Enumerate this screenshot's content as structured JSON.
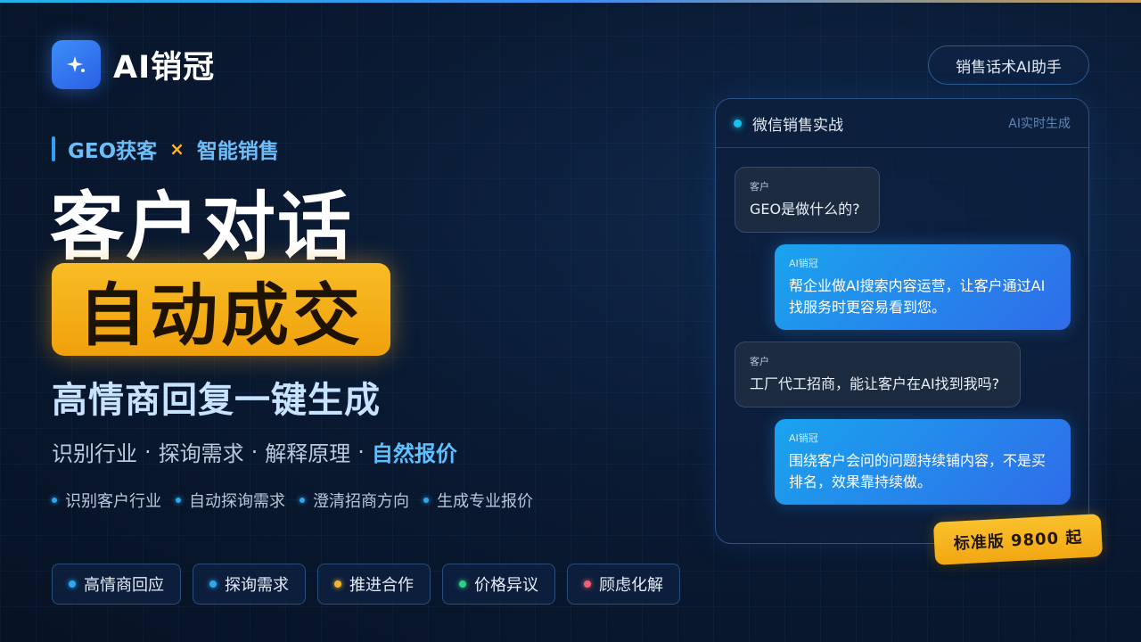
{
  "brand": {
    "name": "AI销冠"
  },
  "header": {
    "assistant_label": "销售话术AI助手"
  },
  "tagline": {
    "left": "GEO获客",
    "sep": "×",
    "right": "智能销售"
  },
  "hero": {
    "line1": "客户对话",
    "line2": "自动成交",
    "line3": "高情商回复一键生成"
  },
  "subline": {
    "items": [
      "识别行业",
      "探询需求",
      "解释原理"
    ],
    "highlight": "自然报价",
    "separator": "·"
  },
  "features": [
    "识别客户行业",
    "自动探询需求",
    "澄清招商方向",
    "生成专业报价"
  ],
  "chips": [
    {
      "label": "高情商回应",
      "color": "#2fa6f0"
    },
    {
      "label": "探询需求",
      "color": "#2fa6f0"
    },
    {
      "label": "推进合作",
      "color": "#f4b62c"
    },
    {
      "label": "价格异议",
      "color": "#2ecf86"
    },
    {
      "label": "顾虑化解",
      "color": "#f0606e"
    }
  ],
  "chat": {
    "title": "微信销售实战",
    "status": "AI实时生成",
    "messages": [
      {
        "sender": "客户",
        "text": "GEO是做什么的?"
      },
      {
        "sender": "AI销冠",
        "text": "帮企业做AI搜索内容运营，让客户通过AI找服务时更容易看到您。"
      },
      {
        "sender": "客户",
        "text": "工厂代工招商，能让客户在AI找到我吗?"
      },
      {
        "sender": "AI销冠",
        "text": "围绕客户会问的问题持续铺内容，不是买排名，效果靠持续做。"
      }
    ]
  },
  "price": {
    "label": "标准版 9800 起"
  },
  "colors": {
    "accent": "#2fa6f0",
    "gold": "#f4b62c",
    "background": "#0a1a33"
  }
}
